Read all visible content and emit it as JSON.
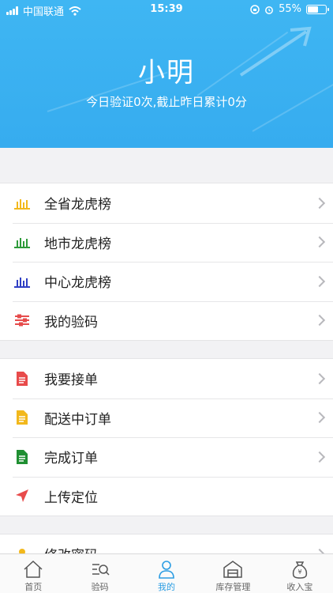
{
  "status_bar": {
    "carrier": "中国联通",
    "time": "15:39",
    "battery": "55%",
    "battery_level": 0.55
  },
  "profile": {
    "name": "小明",
    "summary": "今日验证0次,截止昨日累计0分"
  },
  "menu_group_1": [
    {
      "label": "全省龙虎榜",
      "icon": "bar-chart-icon",
      "color": "#f2b81c"
    },
    {
      "label": "地市龙虎榜",
      "icon": "bar-chart-icon",
      "color": "#2e9b3a"
    },
    {
      "label": "中心龙虎榜",
      "icon": "bar-chart-icon",
      "color": "#2f3fc4"
    },
    {
      "label": "我的验码",
      "icon": "sliders-icon",
      "color": "#e64b4b"
    }
  ],
  "menu_group_2": [
    {
      "label": "我要接单",
      "icon": "document-icon",
      "color": "#e84b4b"
    },
    {
      "label": "配送中订单",
      "icon": "document-icon",
      "color": "#f2b81c"
    },
    {
      "label": "完成订单",
      "icon": "document-icon",
      "color": "#1f8f32"
    },
    {
      "label": "上传定位",
      "icon": "location-arrow-icon",
      "color": "#e84b4b"
    }
  ],
  "menu_group_3": [
    {
      "label": "修改密码",
      "icon": "user-icon",
      "color": "#f2b81c"
    }
  ],
  "tabs": [
    {
      "label": "首页",
      "icon": "home-icon",
      "active": false
    },
    {
      "label": "验码",
      "icon": "scan-search-icon",
      "active": false
    },
    {
      "label": "我的",
      "icon": "person-icon",
      "active": true
    },
    {
      "label": "库存管理",
      "icon": "warehouse-icon",
      "active": false
    },
    {
      "label": "收入宝",
      "icon": "money-bag-icon",
      "active": false
    }
  ],
  "colors": {
    "header": "#3fb6f3",
    "active_tab": "#2c9de3"
  }
}
